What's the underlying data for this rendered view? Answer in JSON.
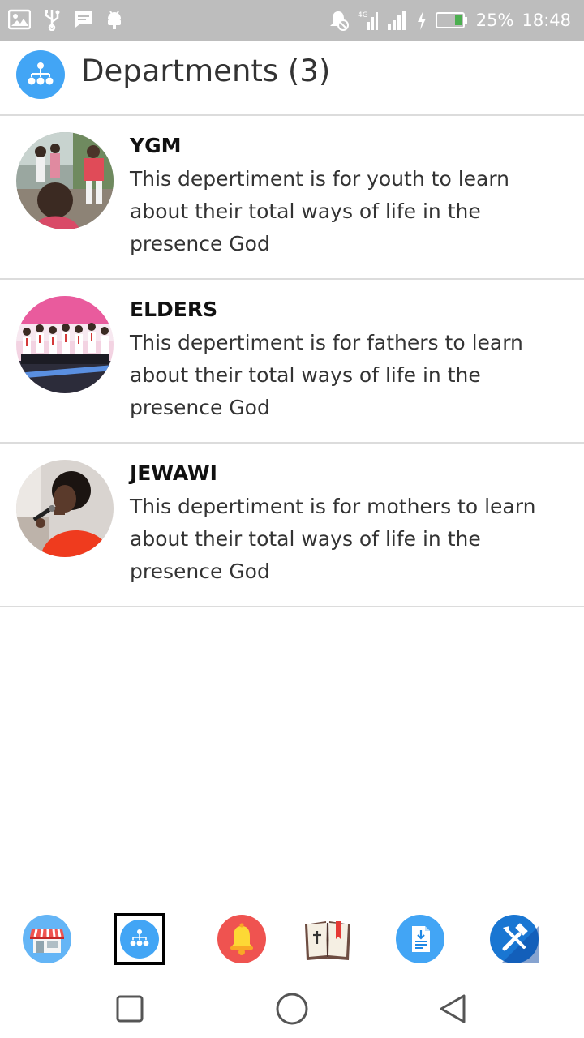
{
  "status_bar": {
    "battery": "25%",
    "time": "18:48",
    "network": "4G"
  },
  "header": {
    "title": "Departments (3)",
    "icon": "org-chart-icon"
  },
  "departments": [
    {
      "name": "YGM",
      "description": "This depertiment is for youth to learn about their total ways of life in the presence God"
    },
    {
      "name": "ELDERS",
      "description": "This depertiment is for fathers to learn about their total ways of life in the presence God"
    },
    {
      "name": "JEWAWI",
      "description": "This depertiment is for mothers to learn about their total ways of life in the presence God"
    }
  ],
  "bottom_tabs": [
    {
      "icon": "store-icon",
      "selected": false
    },
    {
      "icon": "org-chart-icon",
      "selected": true
    },
    {
      "icon": "bell-icon",
      "selected": false
    },
    {
      "icon": "bible-icon",
      "selected": false
    },
    {
      "icon": "document-download-icon",
      "selected": false
    },
    {
      "icon": "tools-icon",
      "selected": false
    }
  ],
  "colors": {
    "accent": "#42a5f5",
    "status_bar": "#bdbdbd",
    "divider": "#dcdcdc",
    "bell": "#ef5350",
    "tools": "#1976d2"
  }
}
